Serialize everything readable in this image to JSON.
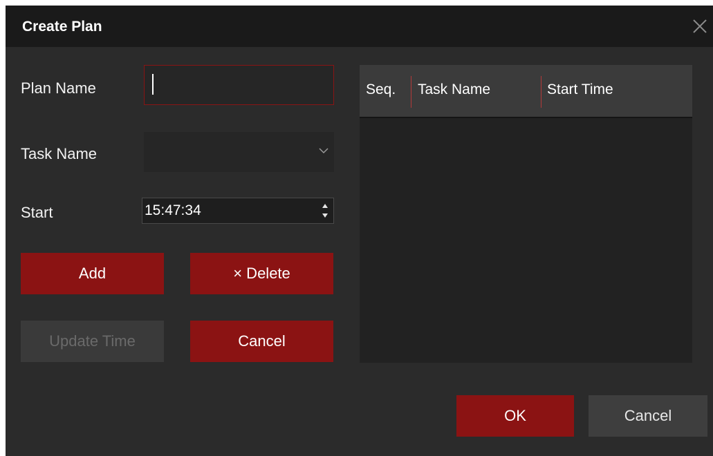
{
  "dialog": {
    "title": "Create Plan",
    "close_icon": "close-icon"
  },
  "form": {
    "plan_name_label": "Plan Name",
    "plan_name_value": "",
    "task_name_label": "Task Name",
    "task_name_selected": "",
    "start_label": "Start",
    "start_time": "15:47:34"
  },
  "actions": {
    "add": "Add",
    "delete": "× Delete",
    "update_time": "Update Time",
    "cancel": "Cancel"
  },
  "table": {
    "columns": [
      "Seq.",
      "Task Name",
      "Start Time"
    ],
    "rows": []
  },
  "footer": {
    "ok": "OK",
    "cancel": "Cancel"
  },
  "colors": {
    "accent": "#8b1313",
    "background": "#2b2b2b",
    "titlebar": "#1a1a1a"
  }
}
